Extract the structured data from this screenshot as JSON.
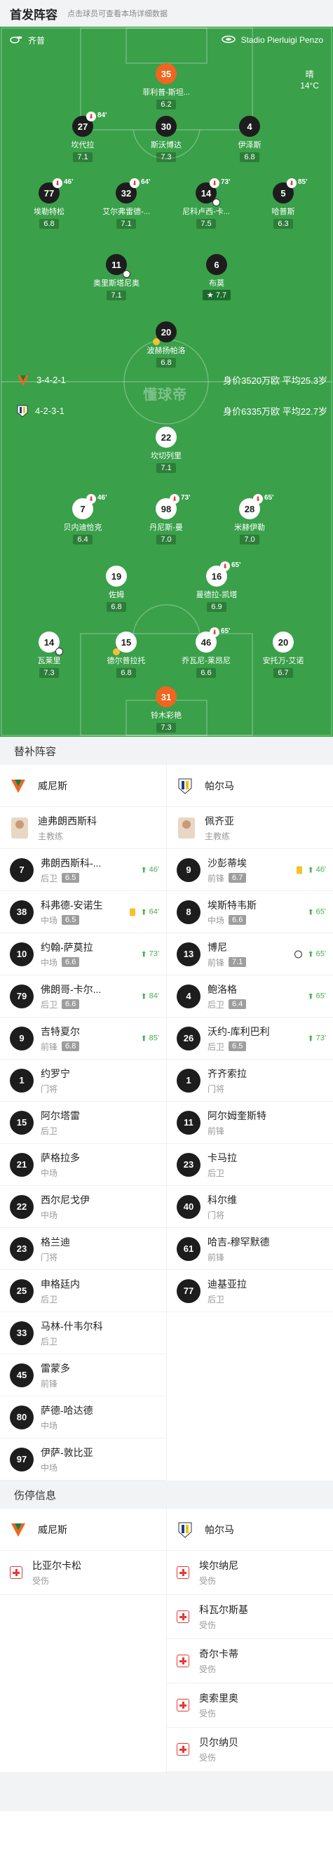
{
  "header": {
    "title": "首发阵容",
    "hint": "点击球员可查看本场详细数据"
  },
  "match": {
    "referee": "齐普",
    "stadium": "Stadio Pierluigi Penzo",
    "weather": "晴",
    "temperature": "14°C",
    "watermark": "懂球帝"
  },
  "home_team": {
    "formation": "3-4-2-1",
    "value": "身价3520万欧 平均25.3岁"
  },
  "away_team": {
    "formation": "4-2-3-1",
    "value": "身价6335万欧 平均22.7岁"
  },
  "home_players": [
    {
      "no": "35",
      "name": "菲利普-斯坦...",
      "rating": "6.2",
      "gk": true
    },
    {
      "no": "27",
      "name": "坎代拉",
      "rating": "7.1",
      "sub": "84'"
    },
    {
      "no": "30",
      "name": "斯沃博达",
      "rating": "7.3"
    },
    {
      "no": "4",
      "name": "伊泽斯",
      "rating": "6.8"
    },
    {
      "no": "77",
      "name": "埃勒特松",
      "rating": "6.8",
      "sub": "46'"
    },
    {
      "no": "32",
      "name": "艾尔弗雷德-...",
      "rating": "7.1",
      "sub": "64'"
    },
    {
      "no": "14",
      "name": "尼科卢西-卡...",
      "rating": "7.5",
      "sub": "73'",
      "goal": true
    },
    {
      "no": "5",
      "name": "哈普斯",
      "rating": "6.3",
      "sub": "85'"
    },
    {
      "no": "11",
      "name": "奥里斯塔尼奥",
      "rating": "7.1"
    },
    {
      "no": "6",
      "name": "布莫",
      "rating": "7.7",
      "best": true
    },
    {
      "no": "20",
      "name": "波赫扬帕洛",
      "rating": "6.8",
      "yellow": true
    }
  ],
  "away_players": [
    {
      "no": "22",
      "name": "坎切列里",
      "rating": "7.1"
    },
    {
      "no": "7",
      "name": "贝内迪恰克",
      "rating": "6.4",
      "sub": "46'"
    },
    {
      "no": "98",
      "name": "丹尼斯-曼",
      "rating": "7.0",
      "sub": "73'"
    },
    {
      "no": "28",
      "name": "米赫伊勒",
      "rating": "7.0",
      "sub": "65'"
    },
    {
      "no": "19",
      "name": "佐姆",
      "rating": "6.8"
    },
    {
      "no": "16",
      "name": "蔓德拉-凯塔",
      "rating": "6.9",
      "sub": "65'"
    },
    {
      "no": "14",
      "name": "瓦莱里",
      "rating": "7.3",
      "goal": true
    },
    {
      "no": "15",
      "name": "德尔普拉托",
      "rating": "6.8",
      "yellow": true
    },
    {
      "no": "46",
      "name": "乔瓦尼-莱昂尼",
      "rating": "6.6",
      "sub": "65'"
    },
    {
      "no": "20",
      "name": "安托万-艾诺",
      "rating": "6.7"
    },
    {
      "no": "31",
      "name": "铃木彩艳",
      "rating": "7.3",
      "gk": true
    }
  ],
  "subs_section": {
    "title": "替补阵容",
    "home_name": "威尼斯",
    "away_name": "帕尔马",
    "home_coach": {
      "name": "迪弗朗西斯科",
      "role": "主教练"
    },
    "away_coach": {
      "name": "佩齐亚",
      "role": "主教练"
    },
    "home": [
      {
        "no": "7",
        "name": "弗朗西斯科-...",
        "pos": "后卫",
        "rating": "6.5",
        "time": "46'",
        "kind": "in"
      },
      {
        "no": "38",
        "name": "科弗德-安诺生",
        "pos": "中场",
        "rating": "6.5",
        "time": "64'",
        "kind": "in",
        "yellow": true
      },
      {
        "no": "10",
        "name": "约翰-萨莫拉",
        "pos": "中场",
        "rating": "6.6",
        "time": "73'",
        "kind": "in"
      },
      {
        "no": "79",
        "name": "佛朗哥-卡尔...",
        "pos": "后卫",
        "rating": "6.6",
        "time": "84'",
        "kind": "in"
      },
      {
        "no": "9",
        "name": "吉特夏尔",
        "pos": "前锋",
        "rating": "6.8",
        "time": "85'",
        "kind": "in"
      },
      {
        "no": "1",
        "name": "约罗宁",
        "pos": "门将"
      },
      {
        "no": "15",
        "name": "阿尔塔雷",
        "pos": "后卫"
      },
      {
        "no": "21",
        "name": "萨格拉多",
        "pos": "中场"
      },
      {
        "no": "22",
        "name": "西尔尼戈伊",
        "pos": "中场"
      },
      {
        "no": "23",
        "name": "格兰迪",
        "pos": "门将"
      },
      {
        "no": "25",
        "name": "申格廷内",
        "pos": "后卫"
      },
      {
        "no": "33",
        "name": "马林-什韦尔科",
        "pos": "后卫"
      },
      {
        "no": "45",
        "name": "雷蒙多",
        "pos": "前锋"
      },
      {
        "no": "80",
        "name": "萨德-哈达德",
        "pos": "中场"
      },
      {
        "no": "97",
        "name": "伊萨-敦比亚",
        "pos": "中场"
      }
    ],
    "away": [
      {
        "no": "9",
        "name": "沙彭蒂埃",
        "pos": "前锋",
        "rating": "6.7",
        "time": "46'",
        "kind": "in",
        "yellow": true
      },
      {
        "no": "8",
        "name": "埃斯特韦斯",
        "pos": "中场",
        "rating": "6.6",
        "time": "65'",
        "kind": "in"
      },
      {
        "no": "13",
        "name": "博尼",
        "pos": "前锋",
        "rating": "7.1",
        "time": "65'",
        "kind": "in",
        "goal": true
      },
      {
        "no": "4",
        "name": "鲍洛格",
        "pos": "后卫",
        "rating": "6.4",
        "time": "65'",
        "kind": "in"
      },
      {
        "no": "26",
        "name": "沃约-库利巴利",
        "pos": "后卫",
        "rating": "6.5",
        "time": "73'",
        "kind": "in"
      },
      {
        "no": "1",
        "name": "齐齐索拉",
        "pos": "门将"
      },
      {
        "no": "11",
        "name": "阿尔姆奎斯特",
        "pos": "前锋"
      },
      {
        "no": "23",
        "name": "卡马拉",
        "pos": "后卫"
      },
      {
        "no": "40",
        "name": "科尔维",
        "pos": "门将"
      },
      {
        "no": "61",
        "name": "哈吉-穆罕默德",
        "pos": "前锋"
      },
      {
        "no": "77",
        "name": "迪基亚拉",
        "pos": "后卫"
      }
    ]
  },
  "injury_section": {
    "title": "伤停信息",
    "home_name": "威尼斯",
    "away_name": "帕尔马",
    "home": [
      {
        "name": "比亚尔卡松",
        "status": "受伤"
      }
    ],
    "away": [
      {
        "name": "埃尔纳尼",
        "status": "受伤"
      },
      {
        "name": "科瓦尔斯基",
        "status": "受伤"
      },
      {
        "name": "奇尔卡蒂",
        "status": "受伤"
      },
      {
        "name": "奥索里奥",
        "status": "受伤"
      },
      {
        "name": "贝尔纳贝",
        "status": "受伤"
      }
    ]
  },
  "colors": {
    "pitch": "#3aa04a",
    "goalkeeper": "#f06520",
    "sub_in": "#4caf50",
    "injury": "#e53935"
  }
}
